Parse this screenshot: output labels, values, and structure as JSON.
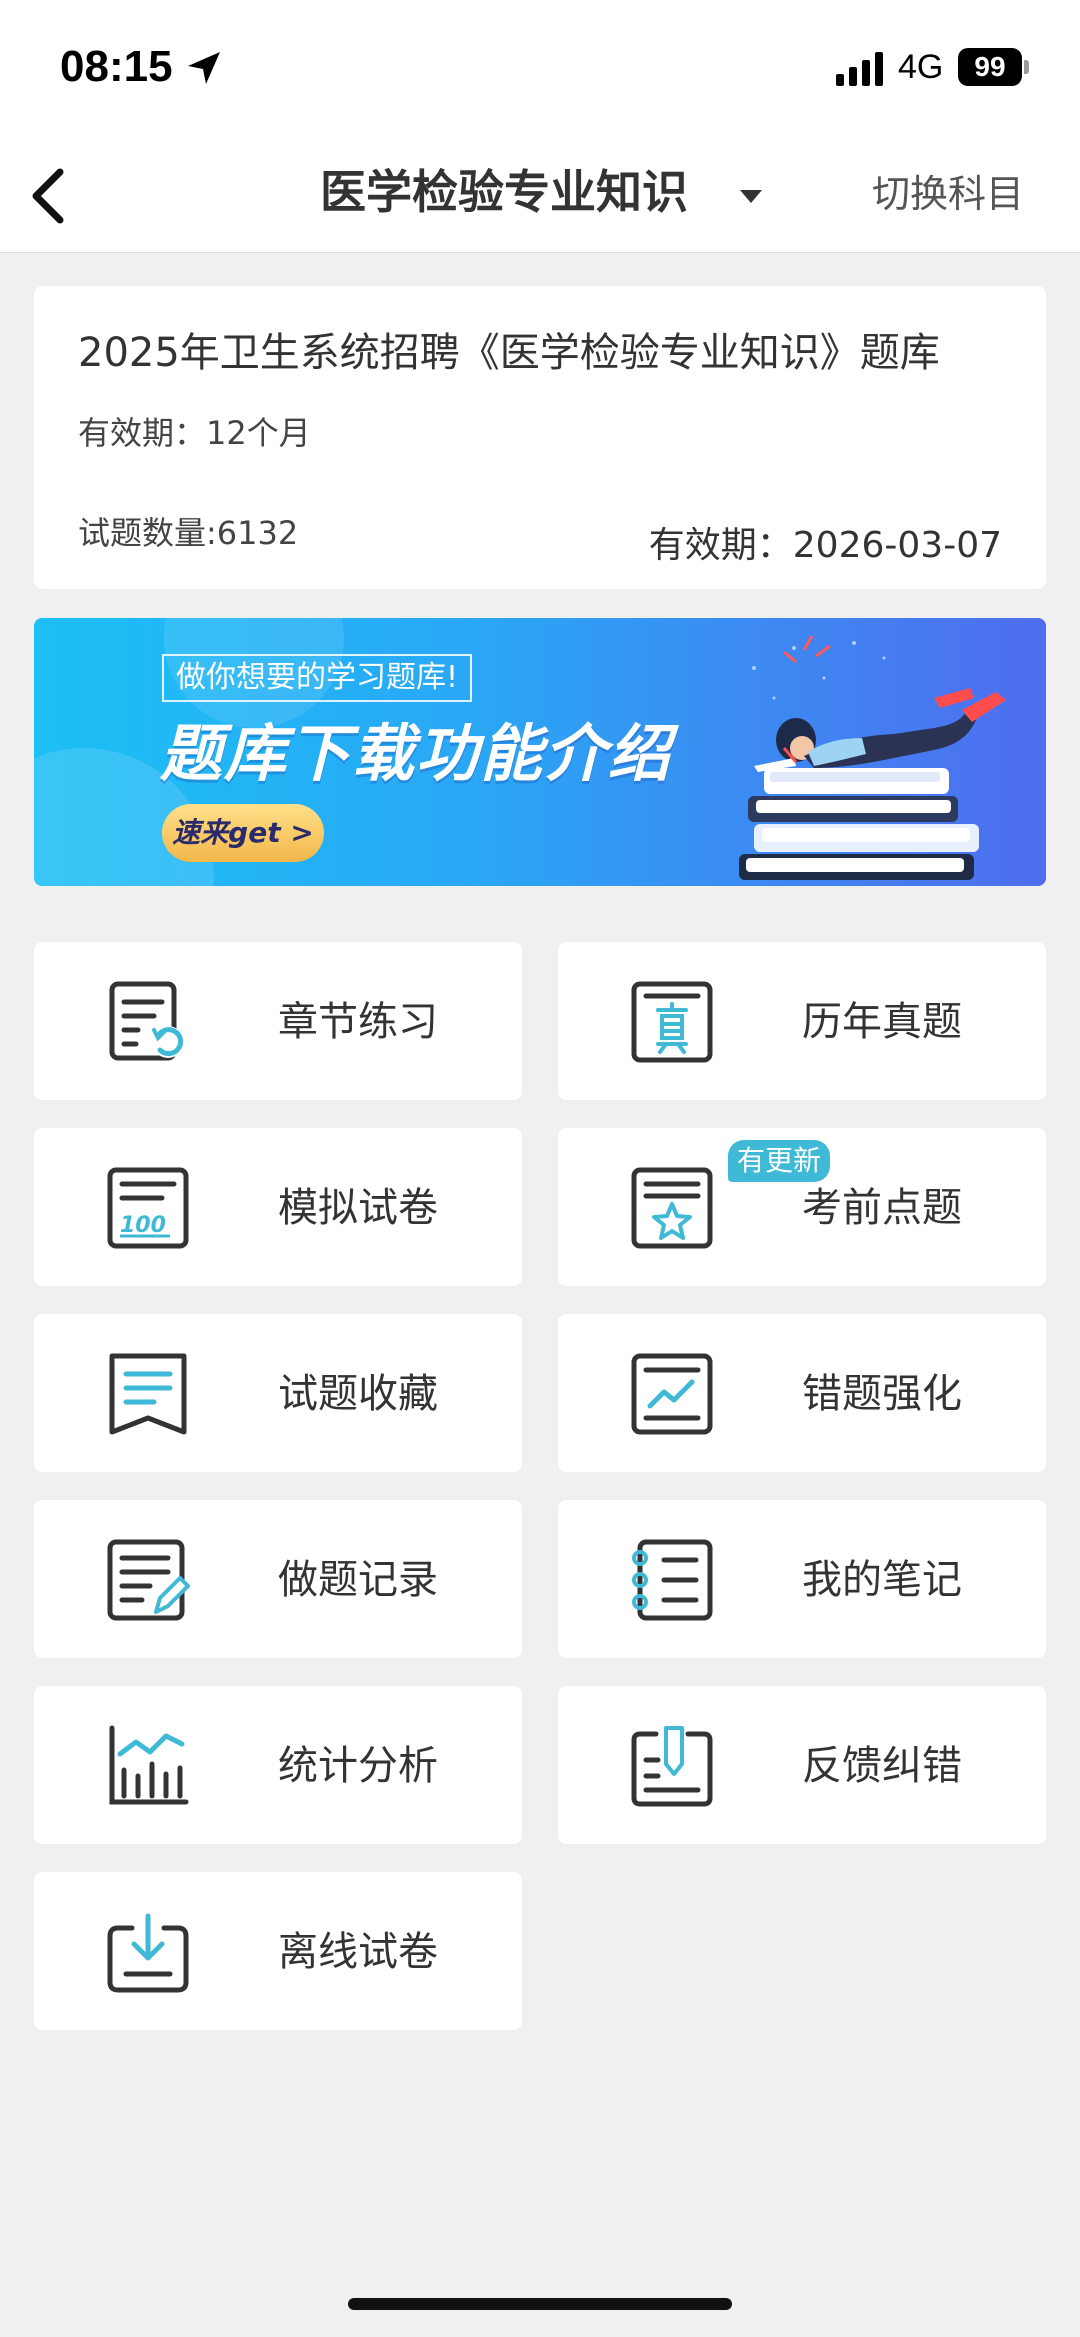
{
  "status_bar": {
    "time": "08:15",
    "network": "4G",
    "battery": "99"
  },
  "nav": {
    "title": "医学检验专业知识",
    "switch_label": "切换科目"
  },
  "info": {
    "title": "2025年卫生系统招聘《医学检验专业知识》题库",
    "validity": "有效期：12个月",
    "question_count": "试题数量:6132",
    "expire": "有效期：2026-03-07"
  },
  "banner": {
    "tag": "做你想要的学习题库!",
    "headline": "题库下载功能介绍",
    "button": "速来get >"
  },
  "menu": {
    "items": [
      {
        "label": "章节练习",
        "icon": "chapter-practice-icon"
      },
      {
        "label": "历年真题",
        "icon": "past-exams-icon"
      },
      {
        "label": "模拟试卷",
        "icon": "mock-exam-icon"
      },
      {
        "label": "考前点题",
        "icon": "pre-exam-tips-icon",
        "badge": "有更新"
      },
      {
        "label": "试题收藏",
        "icon": "bookmark-icon"
      },
      {
        "label": "错题强化",
        "icon": "wrong-questions-icon"
      },
      {
        "label": "做题记录",
        "icon": "practice-record-icon"
      },
      {
        "label": "我的笔记",
        "icon": "notes-icon"
      },
      {
        "label": "统计分析",
        "icon": "statistics-icon"
      },
      {
        "label": "反馈纠错",
        "icon": "feedback-icon"
      },
      {
        "label": "离线试卷",
        "icon": "offline-download-icon"
      }
    ]
  },
  "colors": {
    "accent": "#3fb9d6",
    "icon_dark": "#333333"
  }
}
